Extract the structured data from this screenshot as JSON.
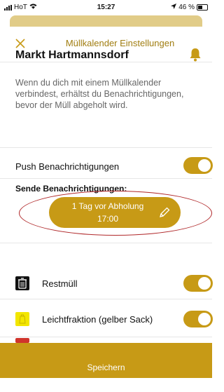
{
  "status_bar": {
    "carrier": "HoT",
    "time": "15:27",
    "battery": "46 %"
  },
  "header": {
    "title": "Müllkalender Einstellungen",
    "close_icon": "close-icon"
  },
  "location": {
    "name": "Markt Hartmannsdorf",
    "description": "Wenn du dich mit einem Müllkalender verbindest, erhältst du Benachrichtigungen, bevor der Müll abgeholt wird."
  },
  "push": {
    "label": "Push Benachrichtigungen",
    "enabled": true
  },
  "notifications": {
    "section_title": "Sende Benachrichtigungen:",
    "time_line1": "1 Tag vor Abholung",
    "time_line2": "17:00"
  },
  "waste_types": [
    {
      "label": "Restmüll",
      "enabled": true,
      "icon": "trash-bin-icon"
    },
    {
      "label": "Leichtfraktion (gelber Sack)",
      "enabled": true,
      "icon": "yellow-bag-icon"
    }
  ],
  "footer": {
    "save_label": "Speichern"
  },
  "colors": {
    "accent": "#c79a16",
    "highlight": "#b0282a"
  }
}
